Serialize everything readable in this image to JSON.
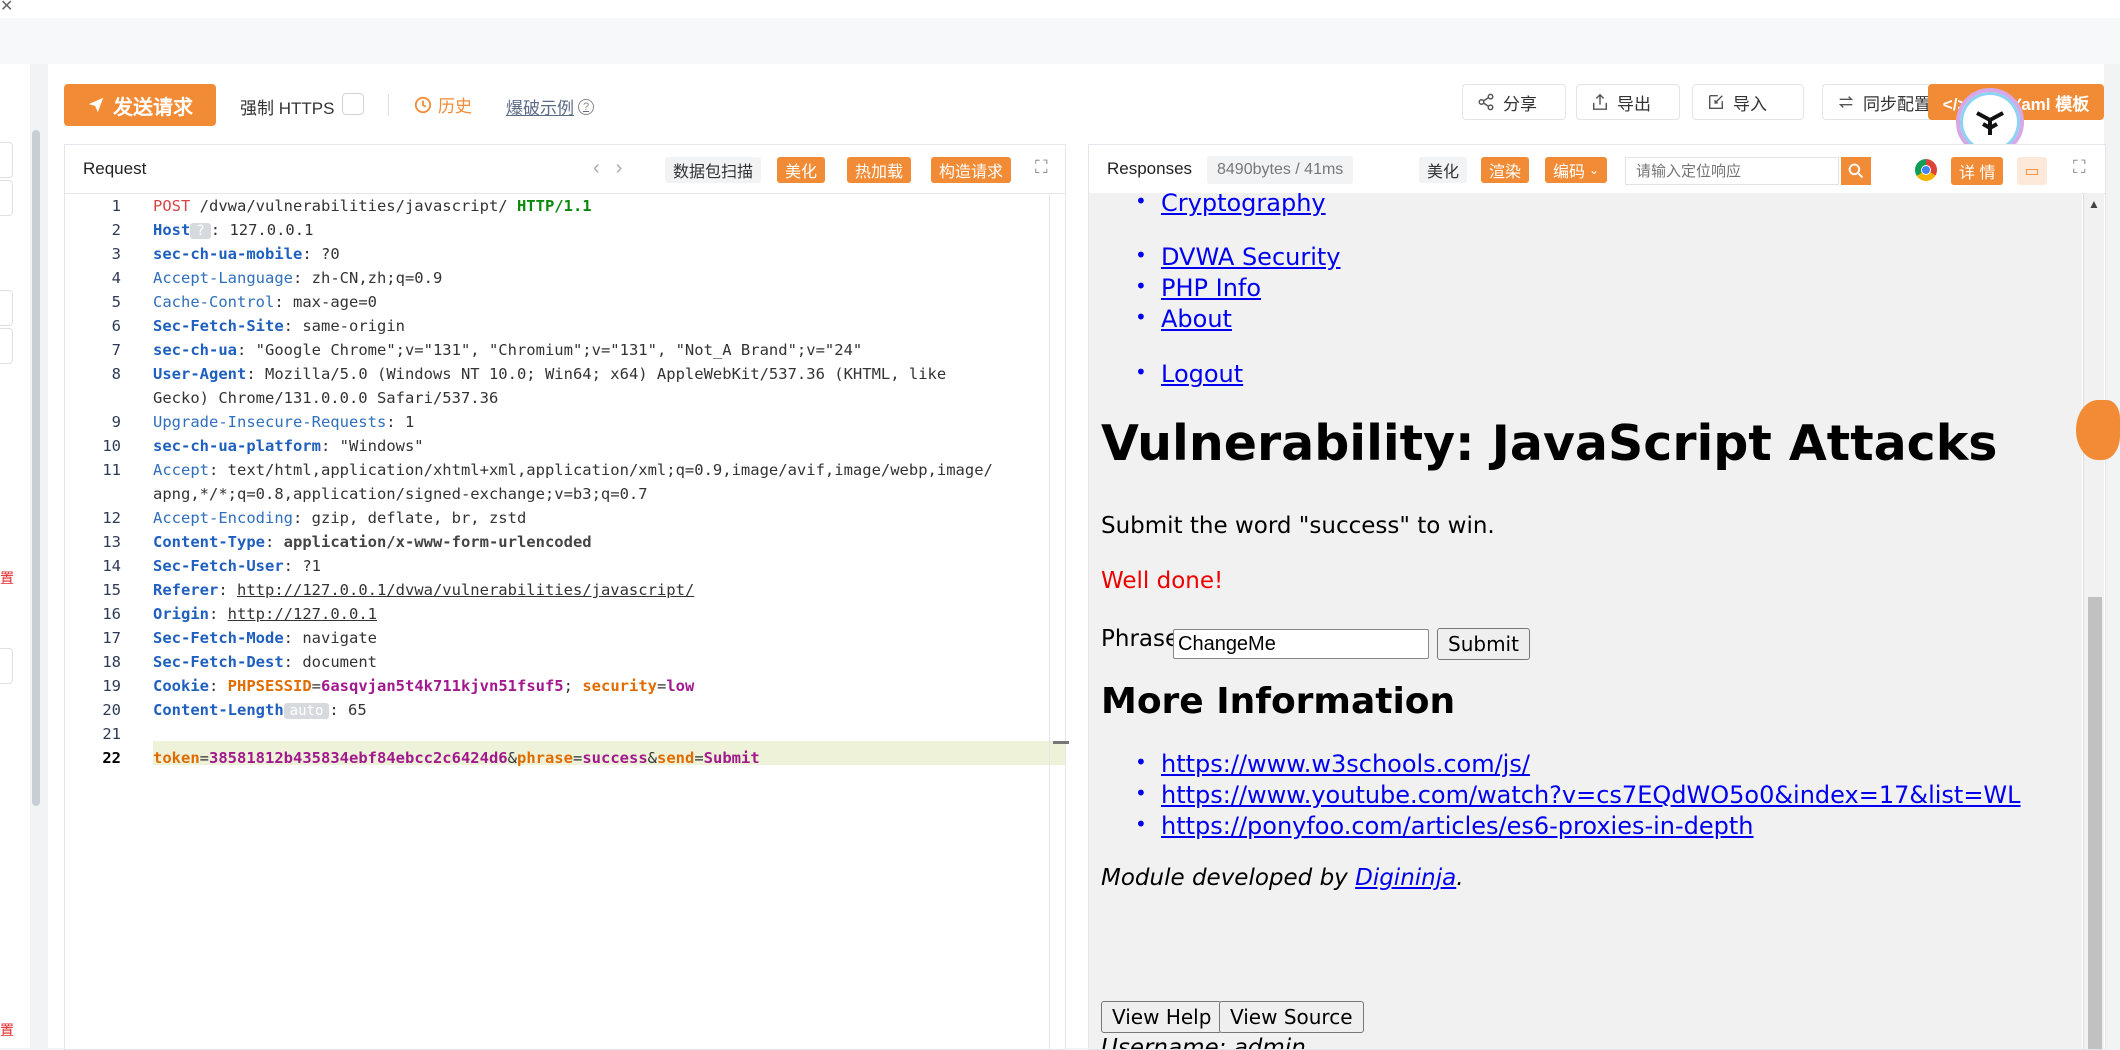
{
  "toolbar": {
    "send_label": "发送请求",
    "force_https_label": "强制 HTTPS",
    "history_label": "历史",
    "burst_example_label": "爆破示例",
    "share_label": "分享",
    "export_label": "导出",
    "import_label": "导入",
    "sync_label": "同步配置",
    "yaml_label": "</> 生成 Yaml 模板"
  },
  "request": {
    "title": "Request",
    "actions": {
      "scan": "数据包扫描",
      "beautify": "美化",
      "hot_load": "热加载",
      "construct": "构造请求"
    },
    "lines": [
      {
        "n": "1",
        "key": "POST",
        "sep": " ",
        "val": "/dvwa/vulnerabilities/javascript/ ",
        "extra": "HTTP/1.1"
      },
      {
        "n": "2",
        "key": "Host",
        "badge": "?",
        "sep": ": ",
        "val": "127.0.0.1"
      },
      {
        "n": "3",
        "key": "sec-ch-ua-mobile",
        "sep": ": ",
        "val": "?0"
      },
      {
        "n": "4",
        "key": "Accept-Language",
        "sep": ": ",
        "val": "zh-CN,zh;q=0.9"
      },
      {
        "n": "5",
        "key": "Cache-Control",
        "sep": ": ",
        "val": "max-age=0"
      },
      {
        "n": "6",
        "key": "Sec-Fetch-Site",
        "sep": ": ",
        "val": "same-origin"
      },
      {
        "n": "7",
        "key": "sec-ch-ua",
        "sep": ": ",
        "val": "\"Google Chrome\";v=\"131\", \"Chromium\";v=\"131\", \"Not_A Brand\";v=\"24\""
      },
      {
        "n": "8",
        "key": "User-Agent",
        "sep": ": ",
        "val": "Mozilla/5.0 (Windows NT 10.0; Win64; x64) AppleWebKit/537.36 (KHTML, like",
        "cont": "Gecko) Chrome/131.0.0.0 Safari/537.36"
      },
      {
        "n": "9",
        "key": "Upgrade-Insecure-Requests",
        "sep": ": ",
        "val": "1"
      },
      {
        "n": "10",
        "key": "sec-ch-ua-platform",
        "sep": ": ",
        "val": "\"Windows\""
      },
      {
        "n": "11",
        "key": "Accept",
        "sep": ": ",
        "val": "text/html,application/xhtml+xml,application/xml;q=0.9,image/avif,image/webp,image/",
        "cont": "apng,*/*;q=0.8,application/signed-exchange;v=b3;q=0.7"
      },
      {
        "n": "12",
        "key": "Accept-Encoding",
        "sep": ": ",
        "val": "gzip, deflate, br, zstd"
      },
      {
        "n": "13",
        "key": "Content-Type",
        "sep": ": ",
        "val": "application/x-www-form-urlencoded"
      },
      {
        "n": "14",
        "key": "Sec-Fetch-User",
        "sep": ": ",
        "val": "?1"
      },
      {
        "n": "15",
        "key": "Referer",
        "sep": ": ",
        "val": "http://127.0.0.1/dvwa/vulnerabilities/javascript/"
      },
      {
        "n": "16",
        "key": "Origin",
        "sep": ": ",
        "val": "http://127.0.0.1"
      },
      {
        "n": "17",
        "key": "Sec-Fetch-Mode",
        "sep": ": ",
        "val": "navigate"
      },
      {
        "n": "18",
        "key": "Sec-Fetch-Dest",
        "sep": ": ",
        "val": "document"
      },
      {
        "n": "19",
        "key": "Cookie",
        "sep": ": "
      },
      {
        "n": "20",
        "key": "Content-Length",
        "badge": "auto",
        "sep": ": ",
        "val": "65"
      },
      {
        "n": "21"
      },
      {
        "n": "22"
      }
    ],
    "cookie": {
      "k1": "PHPSESSID",
      "v1": "6asqvjan5t4k711kjvn51fsuf5",
      "k2": "security",
      "v2": "low"
    },
    "body": {
      "k1": "token",
      "v1": "38581812b435834ebf84ebcc2c6424d6",
      "k2": "phrase",
      "v2": "success",
      "k3": "send",
      "v3": "Submit"
    }
  },
  "response": {
    "title": "Responses",
    "size": "8490bytes / 41ms",
    "beautify": "美化",
    "render": "渲染",
    "encoding": "编码",
    "search_placeholder": "请输入定位响应",
    "detail": "详 情",
    "page": {
      "menu_links": [
        "Cryptography",
        "DVWA Security",
        "PHP Info",
        "About",
        "Logout"
      ],
      "heading": "Vulnerability: JavaScript Attacks",
      "instruction": "Submit the word \"success\" to win.",
      "result": "Well done!",
      "phrase_label": "Phrase",
      "phrase_value": "ChangeMe",
      "submit": "Submit",
      "more_info": "More Information",
      "links": [
        "https://www.w3schools.com/js/",
        "https://www.youtube.com/watch?v=cs7EQdWO5o0&index=17&list=WL",
        "https://ponyfoo.com/articles/es6-proxies-in-depth"
      ],
      "module_prefix": "Module developed by ",
      "module_author": "Digininja",
      "module_suffix": ".",
      "view_help": "View Help",
      "view_source": "View Source",
      "username_line": "Username: admin"
    }
  },
  "left_rail": {
    "marks": [
      "置",
      "置"
    ]
  },
  "colors": {
    "accent": "#f28b35",
    "link": "#0000ee",
    "error": "#e00000"
  }
}
